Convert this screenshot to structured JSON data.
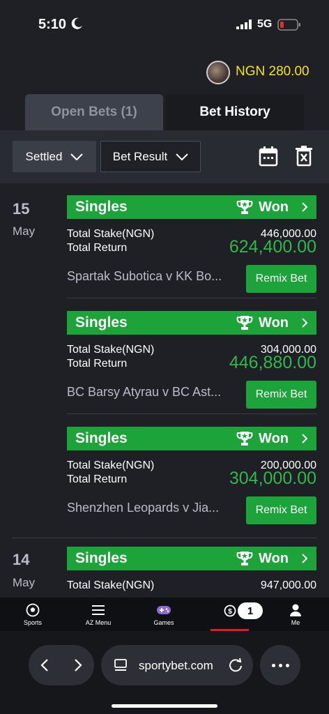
{
  "status_bar": {
    "time": "5:10",
    "network": "5G"
  },
  "header": {
    "balance": "NGN 280.00"
  },
  "tabs": [
    {
      "label": "Open Bets (1)"
    },
    {
      "label": "Bet History"
    }
  ],
  "filters": {
    "settled": "Settled",
    "bet_result": "Bet Result"
  },
  "sections": [
    {
      "day": "15",
      "month": "May"
    },
    {
      "day": "14",
      "month": "May"
    }
  ],
  "bets": [
    {
      "type": "Singles",
      "status": "Won",
      "stake_label": "Total Stake(NGN)",
      "stake": "446,000.00",
      "return_label": "Total Return",
      "return": "624,400.00",
      "match": "Spartak Subotica v KK Bo...",
      "remix": "Remix Bet"
    },
    {
      "type": "Singles",
      "status": "Won",
      "stake_label": "Total Stake(NGN)",
      "stake": "304,000.00",
      "return_label": "Total Return",
      "return": "446,880.00",
      "match": "BC Barsy Atyrau v BC Ast...",
      "remix": "Remix Bet"
    },
    {
      "type": "Singles",
      "status": "Won",
      "stake_label": "Total Stake(NGN)",
      "stake": "200,000.00",
      "return_label": "Total Return",
      "return": "304,000.00",
      "match": "Shenzhen Leopards v Jia...",
      "remix": "Remix Bet"
    },
    {
      "type": "Singles",
      "status": "Won",
      "stake_label": "Total Stake(NGN)",
      "stake": "947,000.00"
    }
  ],
  "bottom_nav": [
    {
      "label": "Sports"
    },
    {
      "label": "AZ Menu"
    },
    {
      "label": "Games"
    },
    {
      "label": "Me"
    }
  ],
  "open_bets_badge": "1",
  "browser": {
    "url": "sportybet.com"
  },
  "colors": {
    "accent_green": "#1ca33a",
    "balance_yellow": "#f5e417",
    "return_green": "#2fb94a",
    "nav_red": "#e41827"
  }
}
